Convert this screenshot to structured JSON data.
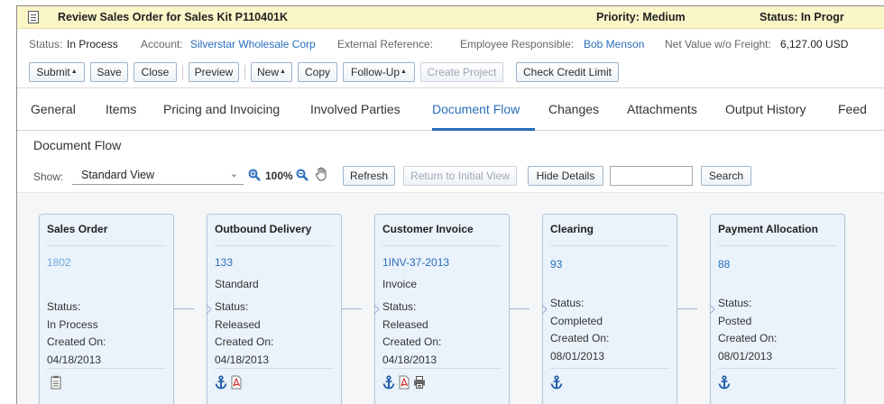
{
  "title_bar": {
    "title": "Review Sales Order for Sales Kit P110401K",
    "priority": "Priority: Medium",
    "status": "Status: In Progr"
  },
  "info": {
    "status_label": "Status:",
    "status_value": "In Process",
    "account_label": "Account:",
    "account_value": "Silverstar Wholesale Corp",
    "external_ref_label": "External Reference:",
    "employee_label": "Employee Responsible:",
    "employee_value": "Bob Menson",
    "net_value_label": "Net Value w/o Freight:",
    "net_value": "6,127.00 USD"
  },
  "toolbar": {
    "submit": "Submit",
    "save": "Save",
    "close": "Close",
    "preview": "Preview",
    "new": "New",
    "copy": "Copy",
    "follow_up": "Follow-Up",
    "create_project": "Create Project",
    "check_credit_limit": "Check Credit Limit",
    "dropdown_glyph": "▲"
  },
  "tabs": [
    {
      "label": "General"
    },
    {
      "label": "Items"
    },
    {
      "label": "Pricing and Invoicing"
    },
    {
      "label": "Involved Parties"
    },
    {
      "label": "Document Flow",
      "active": true
    },
    {
      "label": "Changes"
    },
    {
      "label": "Attachments"
    },
    {
      "label": "Output History"
    },
    {
      "label": "Feed"
    }
  ],
  "section_title": "Document Flow",
  "showbar": {
    "show_label": "Show:",
    "view_value": "Standard View",
    "zoom": "100%",
    "refresh": "Refresh",
    "return_initial": "Return to Initial View",
    "hide_details": "Hide Details",
    "search_value": "",
    "search": "Search"
  },
  "cards": [
    {
      "title": "Sales Order",
      "id": "1802",
      "type": "",
      "status_label": "Status:",
      "status": "In Process",
      "created_label": "Created On:",
      "created": "04/18/2013",
      "icons": [
        "document-icon"
      ]
    },
    {
      "title": "Outbound Delivery",
      "id": "133",
      "type": "Standard",
      "status_label": "Status:",
      "status": "Released",
      "created_label": "Created On:",
      "created": "04/18/2013",
      "icons": [
        "anchor-icon",
        "pdf-icon"
      ]
    },
    {
      "title": "Customer Invoice",
      "id": "1INV-37-2013",
      "type": "Invoice",
      "status_label": "Status:",
      "status": "Released",
      "created_label": "Created On:",
      "created": "04/18/2013",
      "icons": [
        "anchor-icon",
        "pdf-icon",
        "printer-icon"
      ]
    },
    {
      "title": "Clearing",
      "id": "93",
      "type": "",
      "status_label": "Status:",
      "status": "Completed",
      "created_label": "Created On:",
      "created": "08/01/2013",
      "icons": [
        "anchor-icon"
      ]
    },
    {
      "title": "Payment Allocation",
      "id": "88",
      "type": "",
      "status_label": "Status:",
      "status": "Posted",
      "created_label": "Created On:",
      "created": "08/01/2013",
      "icons": [
        "anchor-icon"
      ]
    }
  ],
  "colors": {
    "title_bar_bg": "#fbf6c8",
    "link": "#2a6ebb",
    "card_bg": "#eaf2fb",
    "card_border": "#b6c7da"
  }
}
